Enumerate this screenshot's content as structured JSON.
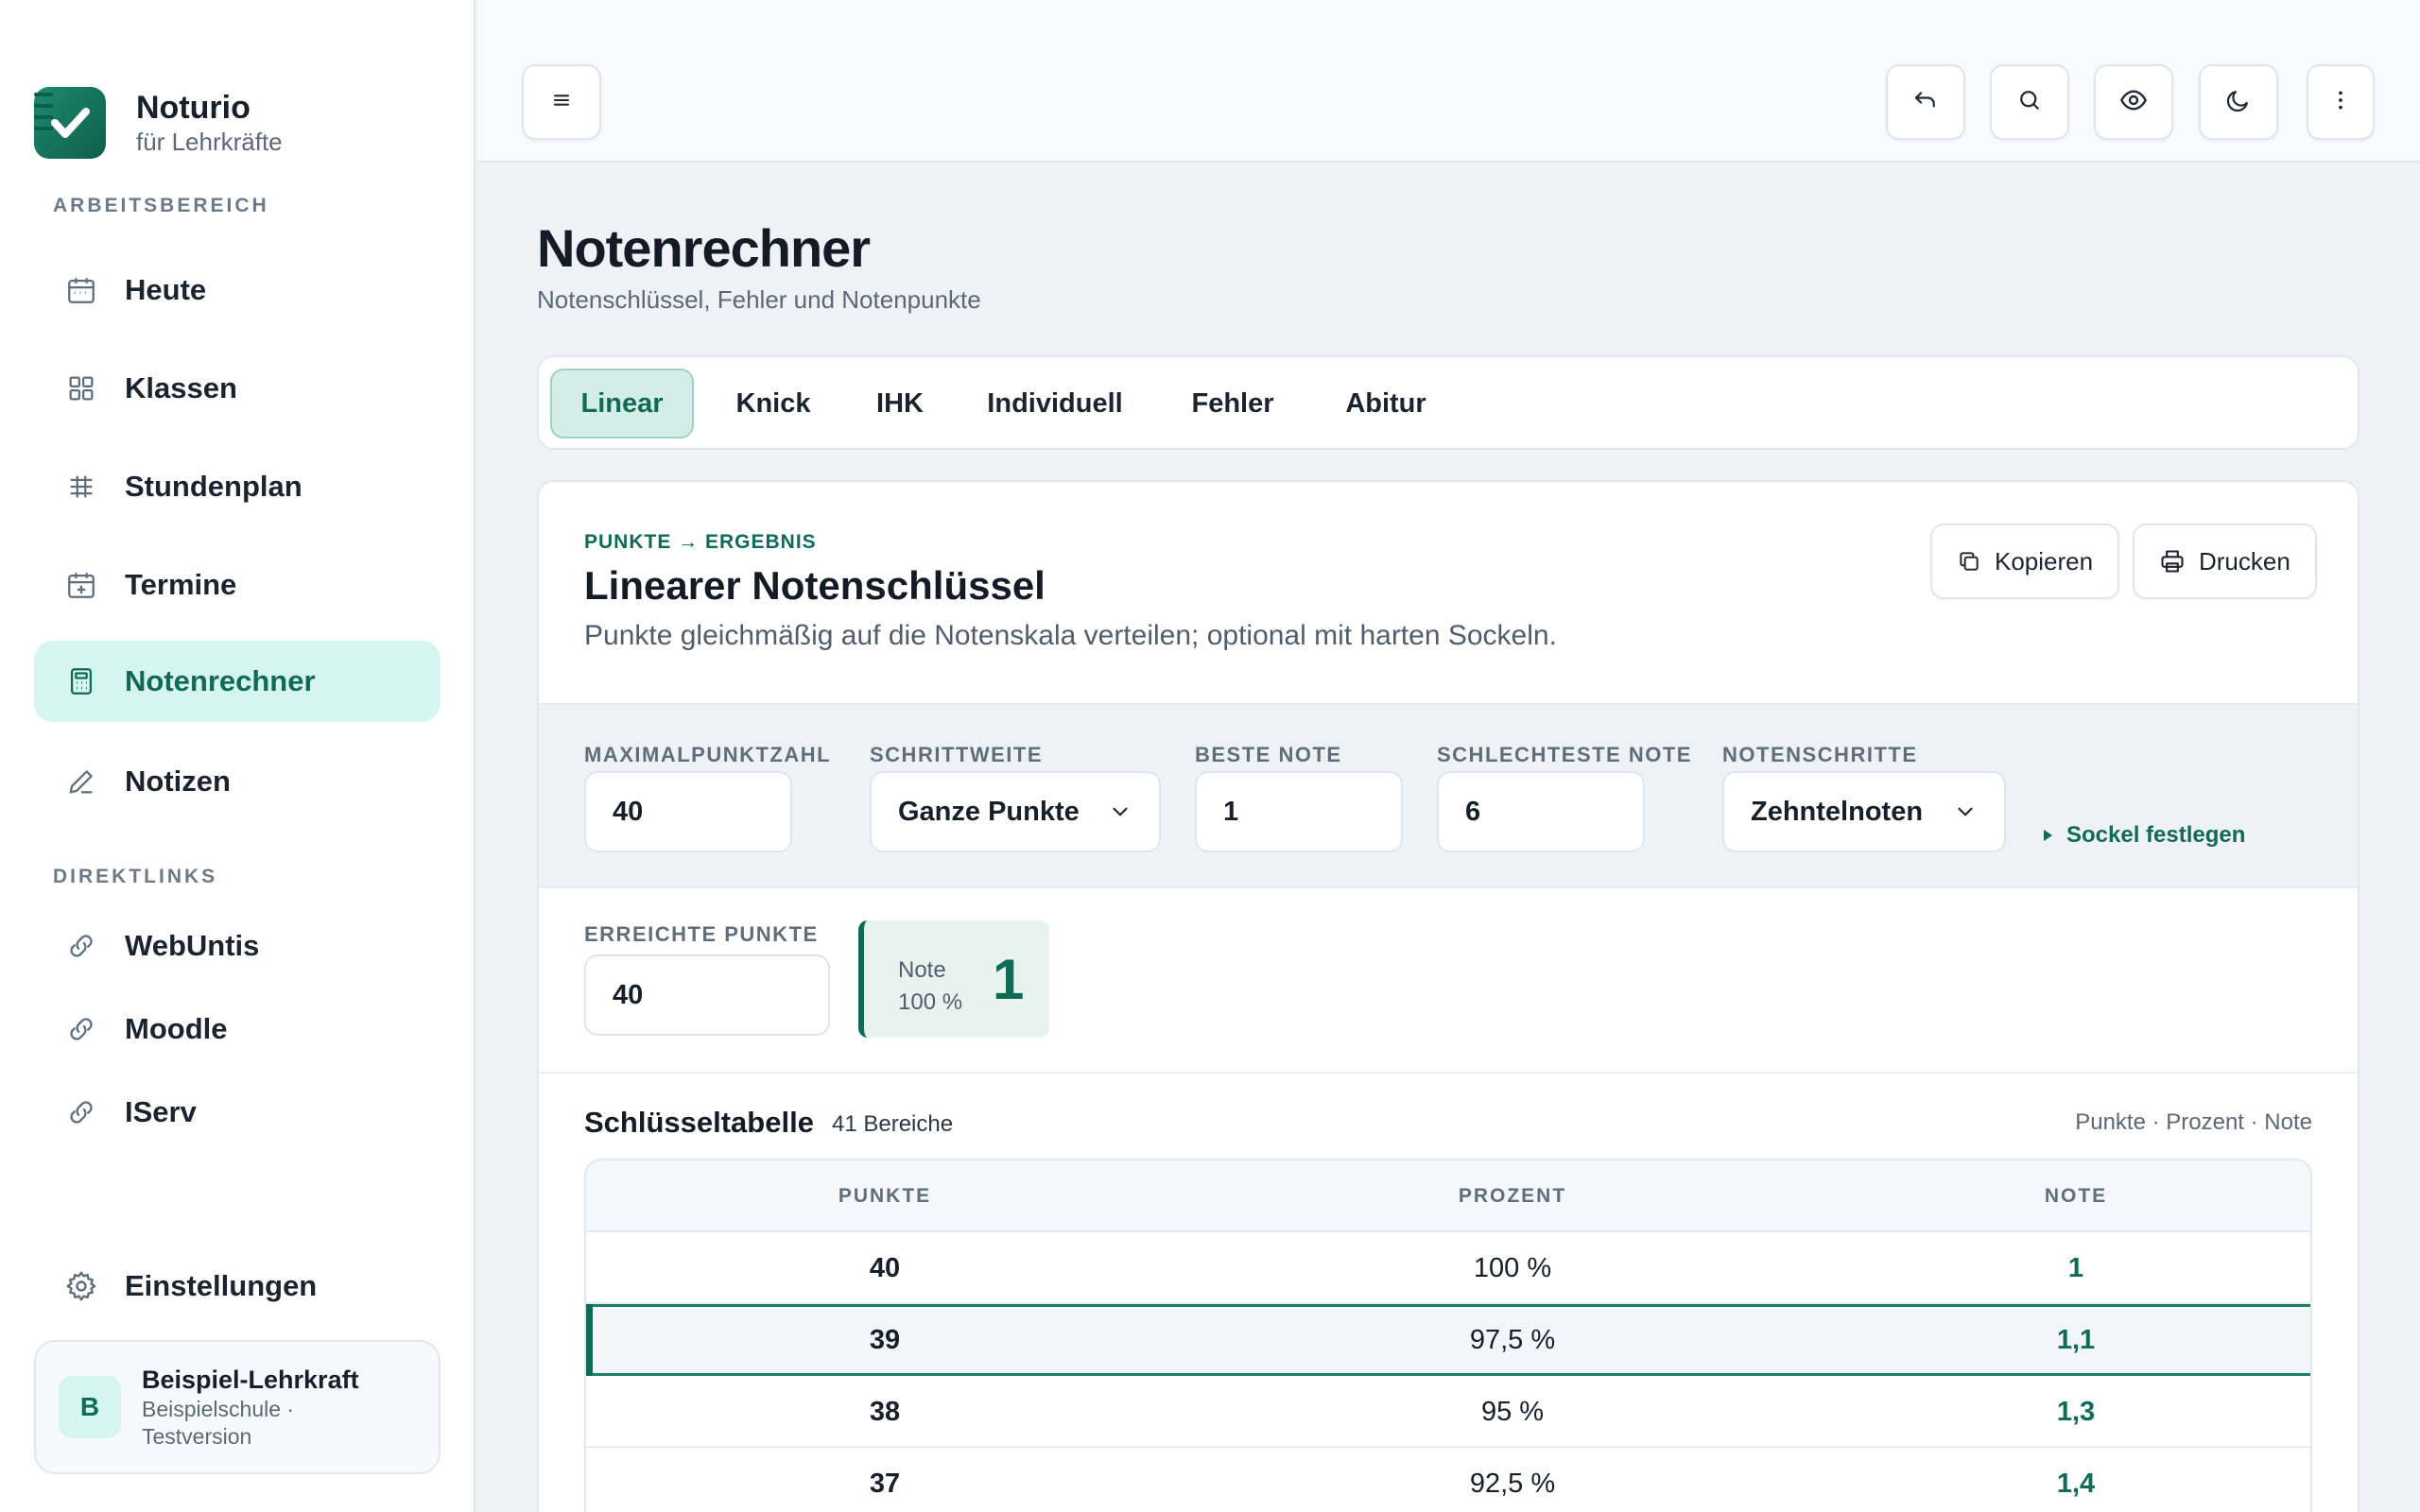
{
  "brand": {
    "name": "Noturio",
    "subtitle": "für Lehrkräfte"
  },
  "sidebar": {
    "section_workspace": "ARBEITSBEREICH",
    "section_links": "DIREKTLINKS",
    "items": [
      {
        "label": "Heute",
        "icon": "calendar-icon"
      },
      {
        "label": "Klassen",
        "icon": "grid-icon"
      },
      {
        "label": "Stundenplan",
        "icon": "timetable-icon"
      },
      {
        "label": "Termine",
        "icon": "calendar-plus-icon"
      },
      {
        "label": "Notenrechner",
        "icon": "calculator-icon",
        "active": true
      },
      {
        "label": "Notizen",
        "icon": "pen-icon"
      }
    ],
    "links": [
      {
        "label": "WebUntis",
        "icon": "link-icon"
      },
      {
        "label": "Moodle",
        "icon": "link-icon"
      },
      {
        "label": "IServ",
        "icon": "link-icon"
      }
    ],
    "settings": {
      "label": "Einstellungen",
      "icon": "gear-icon"
    },
    "user": {
      "initial": "B",
      "name": "Beispiel-Lehrkraft",
      "school": "Beispielschule ·",
      "edition": "Testversion"
    }
  },
  "topbar": {
    "buttons": [
      "menu-icon",
      "undo-icon",
      "search-icon",
      "eye-icon",
      "moon-icon",
      "more-vertical-icon"
    ]
  },
  "page": {
    "title": "Notenrechner",
    "subtitle": "Notenschlüssel, Fehler und Notenpunkte"
  },
  "tabs": [
    {
      "label": "Linear",
      "active": true
    },
    {
      "label": "Knick"
    },
    {
      "label": "IHK"
    },
    {
      "label": "Individuell"
    },
    {
      "label": "Fehler"
    },
    {
      "label": "Abitur"
    }
  ],
  "card": {
    "eyebrow": "PUNKTE → ERGEBNIS",
    "title": "Linearer Notenschlüssel",
    "description": "Punkte gleichmäßig auf die Notenskala verteilen; optional mit harten Sockeln.",
    "copy_label": "Kopieren",
    "print_label": "Drucken"
  },
  "params": {
    "max_points": {
      "label": "MAXIMALPUNKTZAHL",
      "value": "40"
    },
    "step": {
      "label": "SCHRITTWEITE",
      "value": "Ganze Punkte"
    },
    "best_grade": {
      "label": "BESTE NOTE",
      "value": "1"
    },
    "worst_grade": {
      "label": "SCHLECHTESTE NOTE",
      "value": "6"
    },
    "grade_steps": {
      "label": "NOTENSCHRITTE",
      "value": "Zehntelnoten"
    },
    "sockel_label": "Sockel festlegen"
  },
  "result": {
    "points_label": "ERREICHTE PUNKTE",
    "points_value": "40",
    "note_label": "Note",
    "percent": "100 %",
    "grade": "1"
  },
  "table": {
    "title": "Schlüsseltabelle",
    "count": "41 Bereiche",
    "legend": "Punkte · Prozent · Note",
    "headers": [
      "PUNKTE",
      "PROZENT",
      "NOTE"
    ],
    "rows": [
      {
        "points": "40",
        "percent": "100 %",
        "grade": "1"
      },
      {
        "points": "39",
        "percent": "97,5 %",
        "grade": "1,1",
        "highlighted": true
      },
      {
        "points": "38",
        "percent": "95 %",
        "grade": "1,3"
      },
      {
        "points": "37",
        "percent": "92,5 %",
        "grade": "1,4"
      }
    ]
  },
  "colors": {
    "accent": "#0f6b55",
    "accent_soft": "#d6f5ef",
    "background": "#eef2f5"
  }
}
